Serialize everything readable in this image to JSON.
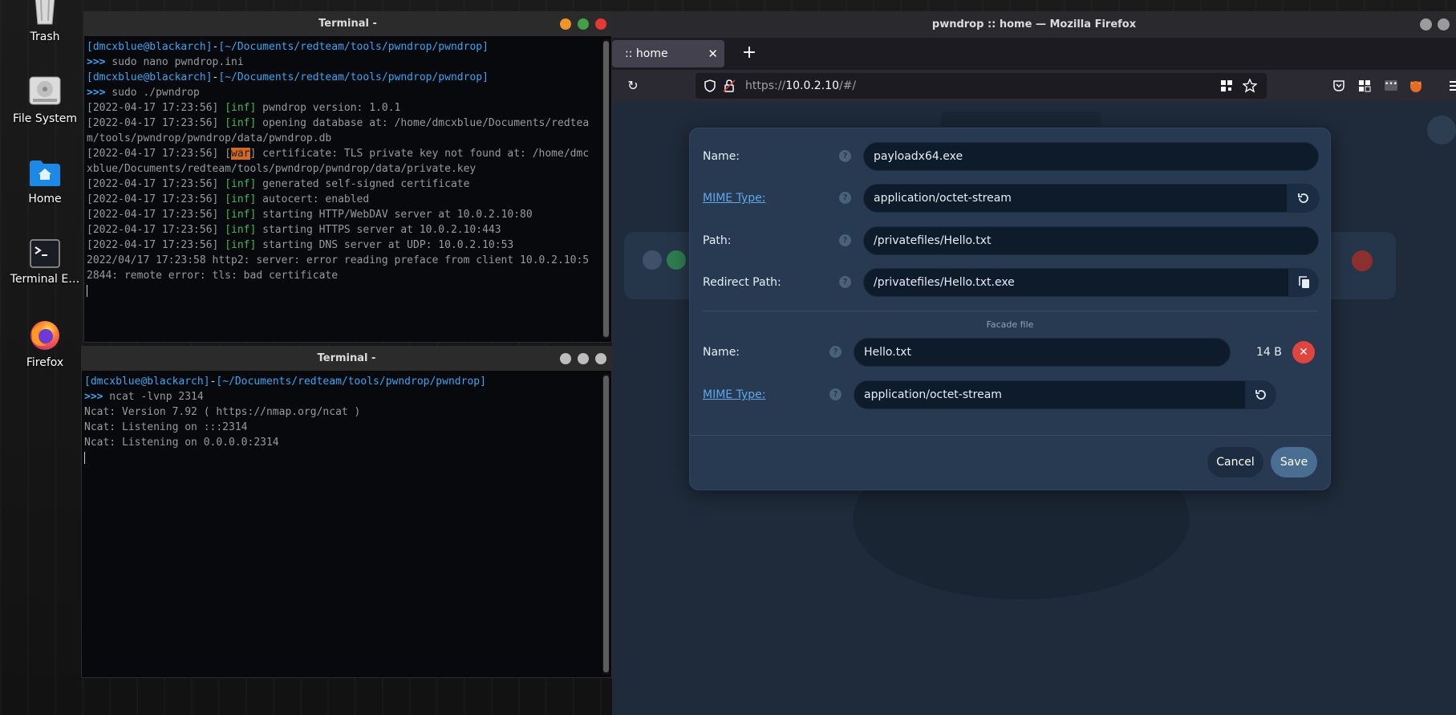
{
  "desktop": {
    "icons": [
      {
        "label": "Trash",
        "icon": "trash-icon"
      },
      {
        "label": "File System",
        "icon": "drive-icon"
      },
      {
        "label": "Home",
        "icon": "home-folder-icon"
      },
      {
        "label": "Terminal E…",
        "icon": "terminal-icon"
      },
      {
        "label": "Firefox",
        "icon": "firefox-icon"
      }
    ]
  },
  "terminal1": {
    "title": "Terminal -",
    "lines": {
      "p1_user": "[dmcxblue@blackarch]",
      "p1_dash": "-",
      "p1_path": "[~/Documents/redteam/tools/pwndrop/pwndrop]",
      "p1_prompt": ">>>",
      "p1_cmd": " sudo nano pwndrop.ini",
      "p2_user": "[dmcxblue@blackarch]",
      "p2_dash": "-",
      "p2_path": "[~/Documents/redteam/tools/pwndrop/pwndrop]",
      "p2_prompt": ">>>",
      "p2_cmd": " sudo ./pwndrop",
      "l1_ts": "[2022-04-17 17:23:56] ",
      "l1_lvl": "[inf]",
      "l1_msg": " pwndrop version: 1.0.1",
      "l2_ts": "[2022-04-17 17:23:56] ",
      "l2_lvl": "[inf]",
      "l2_msg": " opening database at: /home/dmcxblue/Documents/redtea",
      "l2b": "m/tools/pwndrop/pwndrop/data/pwndrop.db",
      "l3_ts": "[2022-04-17 17:23:56] ",
      "l3_lb": "[",
      "l3_lvl": "war",
      "l3_rb": "]",
      "l3_msg": " certificate: TLS private key not found at: /home/dmc",
      "l3b": "xblue/Documents/redteam/tools/pwndrop/pwndrop/data/private.key",
      "l4_ts": "[2022-04-17 17:23:56] ",
      "l4_lvl": "[inf]",
      "l4_msg": " generated self-signed certificate",
      "l5_ts": "[2022-04-17 17:23:56] ",
      "l5_lvl": "[inf]",
      "l5_msg": " autocert: enabled",
      "l6_ts": "[2022-04-17 17:23:56] ",
      "l6_lvl": "[inf]",
      "l6_msg": " starting HTTP/WebDAV server at 10.0.2.10:80",
      "l7_ts": "[2022-04-17 17:23:56] ",
      "l7_lvl": "[inf]",
      "l7_msg": " starting HTTPS server at 10.0.2.10:443",
      "l8_ts": "[2022-04-17 17:23:56] ",
      "l8_lvl": "[inf]",
      "l8_msg": " starting DNS server at UDP: 10.0.2.10:53",
      "l9": "2022/04/17 17:23:58 http2: server: error reading preface from client 10.0.2.10:5",
      "l9b": "2844: remote error: tls: bad certificate"
    }
  },
  "terminal2": {
    "title": "Terminal -",
    "lines": {
      "p_user": "[dmcxblue@blackarch]",
      "p_dash": "-",
      "p_path": "[~/Documents/redteam/tools/pwndrop/pwndrop]",
      "p_prompt": ">>>",
      "p_cmd": " ncat -lvnp 2314",
      "o1": "Ncat: Version 7.92 ( https://nmap.org/ncat )",
      "o2": "Ncat: Listening on :::2314",
      "o3": "Ncat: Listening on 0.0.0.0:2314"
    }
  },
  "firefox": {
    "window_title": "pwndrop :: home — Mozilla Firefox",
    "tab_label": ":: home",
    "url_prefix": "https://",
    "url_host": "10.0.2.10",
    "url_path": "/#/"
  },
  "modal": {
    "name_label": "Name:",
    "name_value": "payloadx64.exe",
    "mime_label": "MIME Type:",
    "mime_value": "application/octet-stream",
    "path_label": "Path:",
    "path_value": "/privatefiles/Hello.txt",
    "redirect_label": "Redirect Path:",
    "redirect_value": "/privatefiles/Hello.txt.exe",
    "facade_title": "Facade file",
    "facade_name_label": "Name:",
    "facade_name_value": "Hello.txt",
    "facade_size": "14 B",
    "facade_mime_label": "MIME Type:",
    "facade_mime_value": "application/octet-stream",
    "cancel_label": "Cancel",
    "save_label": "Save"
  },
  "colors": {
    "modal_bg": "#273a52",
    "input_bg": "#0d1b2a",
    "accent_link": "#5fa8e8",
    "danger": "#e0443e",
    "save_bg": "#4a6d92",
    "prompt_blue": "#3aa5f3",
    "log_green": "#41b95b",
    "warn_orange": "#d26a1f"
  }
}
